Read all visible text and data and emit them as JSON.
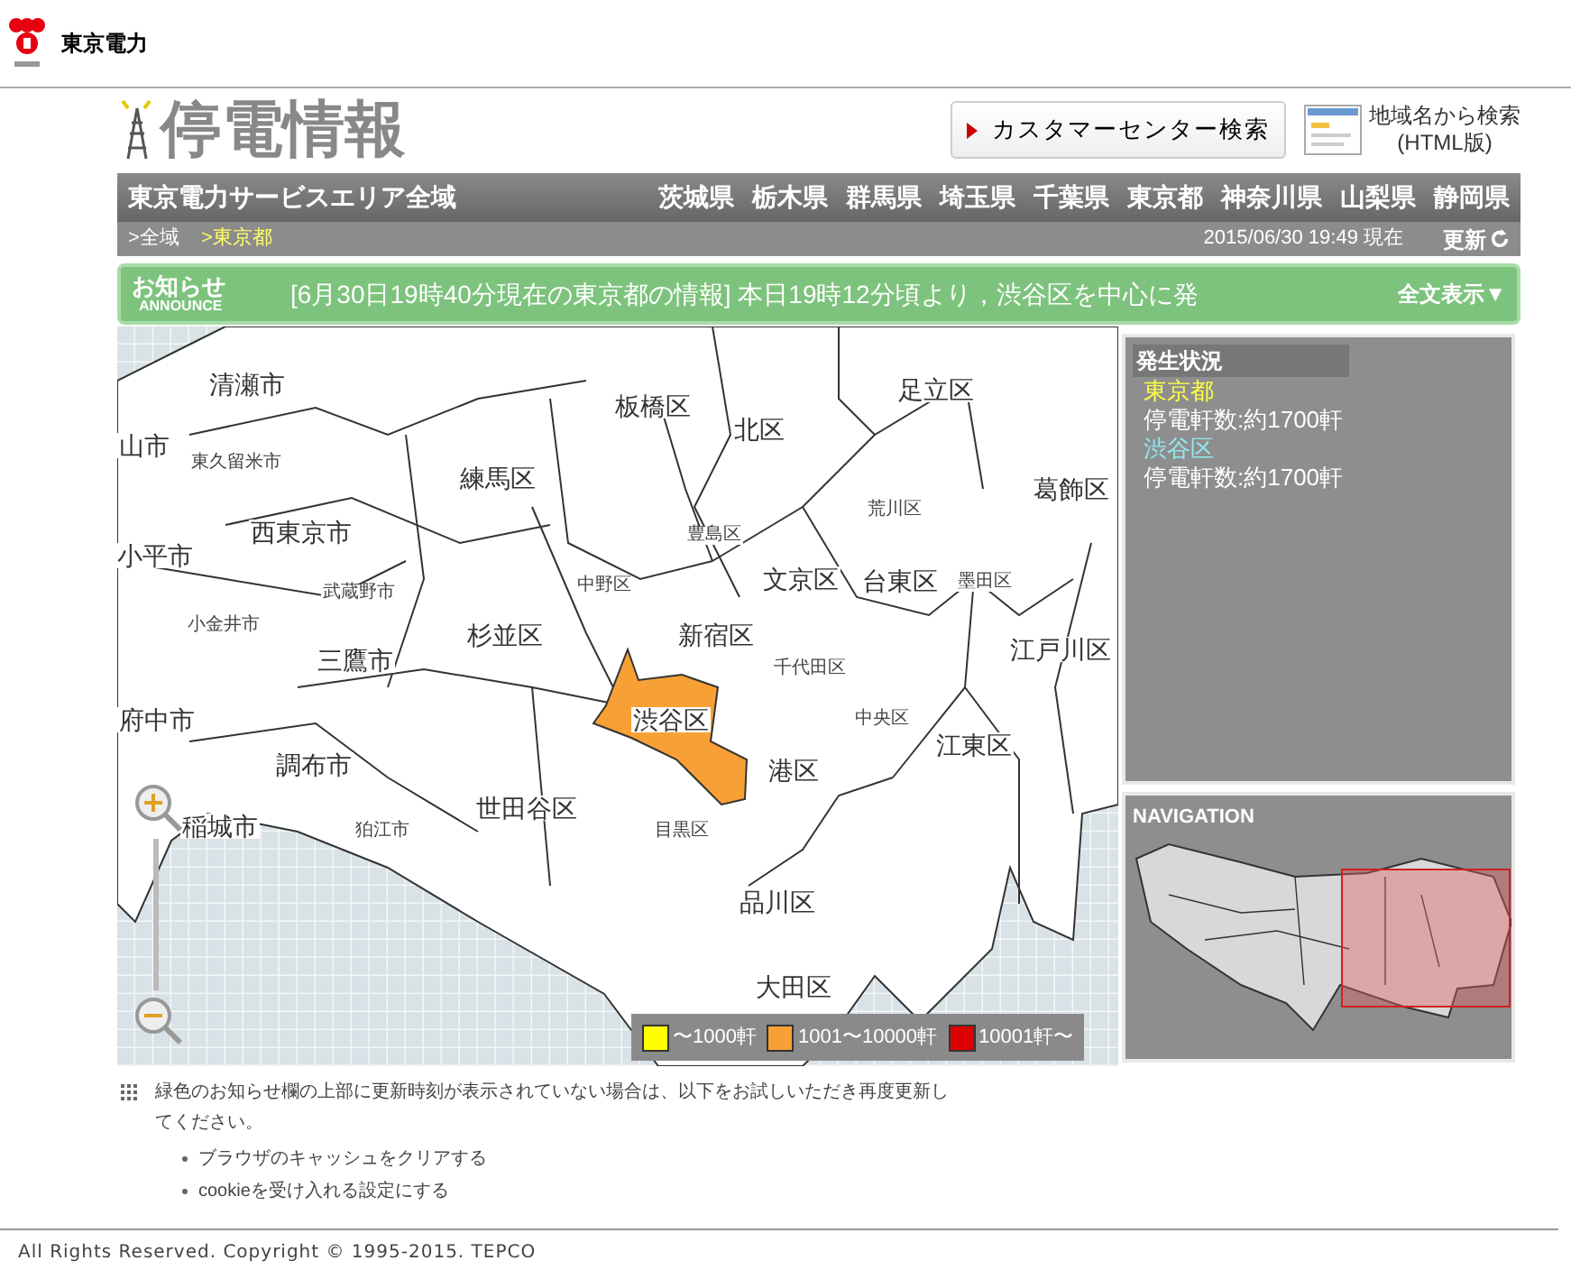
{
  "header": {
    "logo_text": "東京電力"
  },
  "title": "停電情報",
  "customer_center_button": "カスタマーセンター検索",
  "area_search": {
    "line1": "地域名から検索",
    "line2": "(HTML版)"
  },
  "nav": {
    "service_area": "東京電力サービスエリア全域",
    "prefectures": [
      "茨城県",
      "栃木県",
      "群馬県",
      "埼玉県",
      "千葉県",
      "東京都",
      "神奈川県",
      "山梨県",
      "静岡県"
    ]
  },
  "breadcrumb": [
    {
      "label": ">全域",
      "selected": false
    },
    {
      "label": ">東京都",
      "selected": true
    }
  ],
  "timestamp": "2015/06/30 19:49 現在",
  "refresh": "更新",
  "announce": {
    "title": "お知らせ",
    "subtitle": "ANNOUNCE",
    "text": "[6月30日19時40分現在の東京都の情報] 本日19時12分頃より，渋谷区を中心に発",
    "toggle": "全文表示▼"
  },
  "map": {
    "districts": [
      {
        "name": "清瀬市",
        "kind": "major",
        "highlighted": false
      },
      {
        "name": "足立区",
        "kind": "major",
        "highlighted": false
      },
      {
        "name": "板橋区",
        "kind": "major",
        "highlighted": false
      },
      {
        "name": "北区",
        "kind": "major",
        "highlighted": false
      },
      {
        "name": "山市",
        "kind": "major",
        "highlighted": false
      },
      {
        "name": "東久留米市",
        "kind": "minor",
        "highlighted": false
      },
      {
        "name": "練馬区",
        "kind": "major",
        "highlighted": false
      },
      {
        "name": "葛飾区",
        "kind": "major",
        "highlighted": false
      },
      {
        "name": "荒川区",
        "kind": "minor",
        "highlighted": false
      },
      {
        "name": "西東京市",
        "kind": "major",
        "highlighted": false
      },
      {
        "name": "豊島区",
        "kind": "minor",
        "highlighted": false
      },
      {
        "name": "小平市",
        "kind": "major",
        "highlighted": false
      },
      {
        "name": "武蔵野市",
        "kind": "minor",
        "highlighted": false
      },
      {
        "name": "中野区",
        "kind": "minor",
        "highlighted": false
      },
      {
        "name": "文京区",
        "kind": "major",
        "highlighted": false
      },
      {
        "name": "台東区",
        "kind": "major",
        "highlighted": false
      },
      {
        "name": "墨田区",
        "kind": "minor",
        "highlighted": false
      },
      {
        "name": "小金井市",
        "kind": "minor",
        "highlighted": false
      },
      {
        "name": "杉並区",
        "kind": "major",
        "highlighted": false
      },
      {
        "name": "新宿区",
        "kind": "major",
        "highlighted": false
      },
      {
        "name": "江戸川区",
        "kind": "major",
        "highlighted": false
      },
      {
        "name": "三鷹市",
        "kind": "major",
        "highlighted": false
      },
      {
        "name": "千代田区",
        "kind": "minor",
        "highlighted": false
      },
      {
        "name": "府中市",
        "kind": "major",
        "highlighted": false
      },
      {
        "name": "渋谷区",
        "kind": "major",
        "highlighted": true
      },
      {
        "name": "中央区",
        "kind": "minor",
        "highlighted": false
      },
      {
        "name": "江東区",
        "kind": "major",
        "highlighted": false
      },
      {
        "name": "調布市",
        "kind": "major",
        "highlighted": false
      },
      {
        "name": "港区",
        "kind": "major",
        "highlighted": false
      },
      {
        "name": "世田谷区",
        "kind": "major",
        "highlighted": false
      },
      {
        "name": "稲城市",
        "kind": "major",
        "highlighted": false
      },
      {
        "name": "狛江市",
        "kind": "minor",
        "highlighted": false
      },
      {
        "name": "目黒区",
        "kind": "minor",
        "highlighted": false
      },
      {
        "name": "品川区",
        "kind": "major",
        "highlighted": false
      },
      {
        "name": "大田区",
        "kind": "major",
        "highlighted": false
      }
    ],
    "legend": [
      {
        "label": "〜1000軒",
        "color": "#ffff00"
      },
      {
        "label": "1001〜10000軒",
        "color": "#f7a035"
      },
      {
        "label": "10001軒〜",
        "color": "#dd0000"
      }
    ]
  },
  "status_panel": {
    "title": "発生状況",
    "entries": [
      {
        "area": "東京都",
        "kind": "prefecture",
        "count": "停電軒数:約1700軒"
      },
      {
        "area": "渋谷区",
        "kind": "ward",
        "count": "停電軒数:約1700軒"
      }
    ]
  },
  "navigation": {
    "title": "NAVIGATION"
  },
  "notice": {
    "text": "緑色のお知らせ欄の上部に更新時刻が表示されていない場合は、以下をお試しいただき再度更新してください。",
    "bullets": [
      "ブラウザのキャッシュをクリアする",
      "cookieを受け入れる設定にする"
    ]
  },
  "copyright": "All Rights Reserved. Copyright © 1995-2015. TEPCO"
}
